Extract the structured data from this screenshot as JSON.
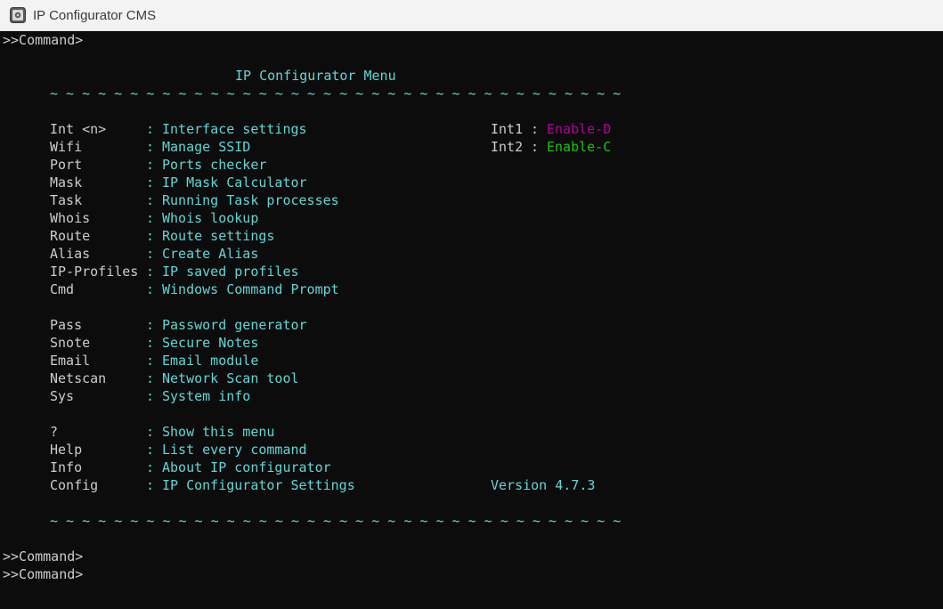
{
  "window": {
    "title": "IP Configurator CMS",
    "icon": "app-window-icon"
  },
  "console": {
    "prompt_top": ">>Command>",
    "menu_title": "IP Configurator Menu",
    "divider": "~ ~ ~ ~ ~ ~ ~ ~ ~ ~ ~ ~ ~ ~ ~ ~ ~ ~ ~ ~ ~ ~ ~ ~ ~ ~ ~ ~ ~ ~ ~ ~ ~ ~ ~ ~",
    "separator": ":",
    "groups": [
      {
        "items": [
          {
            "cmd": "Int <n>",
            "desc": "Interface settings"
          },
          {
            "cmd": "Wifi",
            "desc": "Manage SSID"
          },
          {
            "cmd": "Port",
            "desc": "Ports checker"
          },
          {
            "cmd": "Mask",
            "desc": "IP Mask Calculator"
          },
          {
            "cmd": "Task",
            "desc": "Running Task processes"
          },
          {
            "cmd": "Whois",
            "desc": "Whois lookup"
          },
          {
            "cmd": "Route",
            "desc": "Route settings"
          },
          {
            "cmd": "Alias",
            "desc": "Create Alias"
          },
          {
            "cmd": "IP-Profiles",
            "desc": "IP saved profiles"
          },
          {
            "cmd": "Cmd",
            "desc": "Windows Command Prompt"
          }
        ]
      },
      {
        "items": [
          {
            "cmd": "Pass",
            "desc": "Password generator"
          },
          {
            "cmd": "Snote",
            "desc": "Secure Notes"
          },
          {
            "cmd": "Email",
            "desc": "Email module"
          },
          {
            "cmd": "Netscan",
            "desc": "Network Scan tool"
          },
          {
            "cmd": "Sys",
            "desc": "System info"
          }
        ]
      },
      {
        "items": [
          {
            "cmd": "?",
            "desc": "Show this menu"
          },
          {
            "cmd": "Help",
            "desc": "List every command"
          },
          {
            "cmd": "Info",
            "desc": "About IP configurator"
          },
          {
            "cmd": "Config",
            "desc": "IP Configurator Settings"
          }
        ]
      }
    ],
    "interfaces": [
      {
        "name": "Int1",
        "sep": ":",
        "status": "Enable-D",
        "color": "#b4009e"
      },
      {
        "name": "Int2",
        "sep": ":",
        "status": "Enable-C",
        "color": "#16c60c"
      }
    ],
    "version": "Version 4.7.3",
    "prompts_bottom": [
      ">>Command>",
      ">>Command>"
    ]
  },
  "colors": {
    "background": "#0c0c0c",
    "cyan": "#61d6d6",
    "text": "#cccccc",
    "magenta": "#b4009e",
    "green": "#16c60c"
  }
}
